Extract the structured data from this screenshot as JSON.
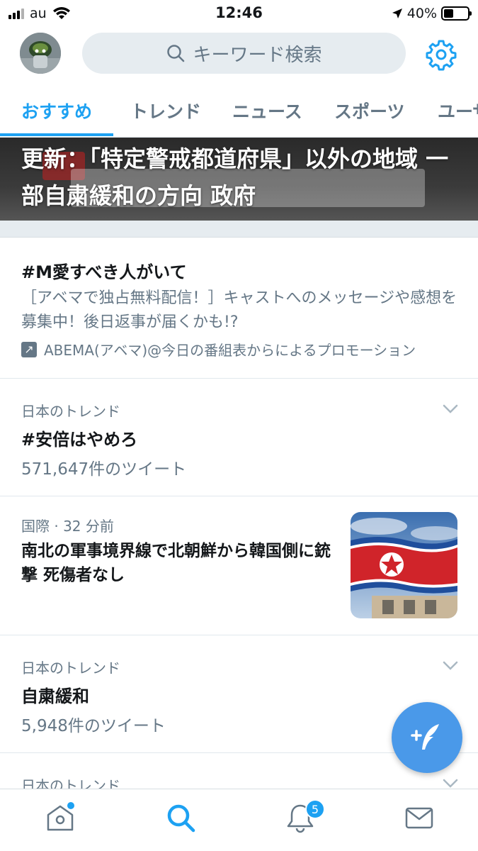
{
  "status_bar": {
    "carrier": "au",
    "time": "12:46",
    "battery": "40%",
    "battery_level": 0.4
  },
  "header": {
    "search_placeholder": "キーワード検索"
  },
  "tabs": [
    {
      "label": "おすすめ",
      "active": true
    },
    {
      "label": "トレンド",
      "active": false
    },
    {
      "label": "ニュース",
      "active": false
    },
    {
      "label": "スポーツ",
      "active": false
    },
    {
      "label": "ユーザ",
      "active": false
    }
  ],
  "hero": {
    "title": "更新：「特定警戒都道府県」以外の地域 一部自粛緩和の方向 政府"
  },
  "promo": {
    "title": "#M愛すべき人がいて",
    "description": "［アベマで独占無料配信！］キャストへのメッセージや感想を募集中！後日返事が届くかも!?",
    "promoted_by": "ABEMA(アベマ)@今日の番組表からによるプロモーション"
  },
  "trends": [
    {
      "meta": "日本のトレンド",
      "title": "#安倍はやめろ",
      "count": "571,647件のツイート"
    },
    {
      "meta": "日本のトレンド",
      "title": "自粛緩和",
      "count": "5,948件のツイート"
    },
    {
      "meta": "日本のトレンド"
    }
  ],
  "news": {
    "meta": "国際 · 32 分前",
    "title": "南北の軍事境界線で北朝鮮から韓国側に銃撃 死傷者なし"
  },
  "bottom_nav": {
    "notifications_badge": "5"
  },
  "colors": {
    "accent": "#1da1f2",
    "secondary_text": "#657786",
    "fab": "#4a99e9"
  }
}
